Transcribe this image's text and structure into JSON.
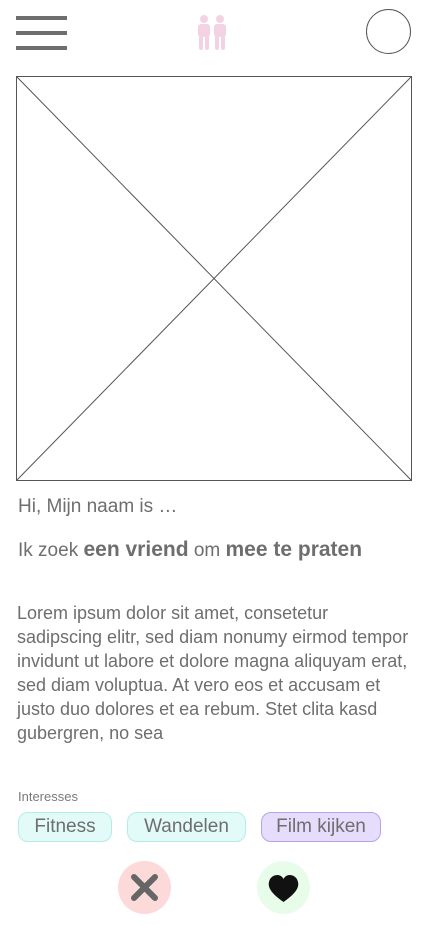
{
  "header": {
    "menu_icon": "hamburger-menu-icon",
    "logo_icon": "couple-logo-icon",
    "logo_color": "#f3d3e3",
    "profile_icon": "avatar-circle"
  },
  "profile": {
    "greeting": "Hi, Mijn naam is …",
    "seek": {
      "prefix": "Ik zoek",
      "emphasis1": "een vriend",
      "middle": "om",
      "emphasis2": "mee te praten"
    },
    "bio": "Lorem ipsum dolor sit amet, consetetur sadipscing elitr, sed diam nonumy eirmod tempor invidunt ut labore et dolore magna aliquyam erat, sed diam voluptua. At vero eos et accusam et justo duo dolores et ea rebum. Stet clita kasd gubergren, no sea"
  },
  "interests": {
    "label": "Interesses",
    "items": [
      "Fitness",
      "Wandelen",
      "Film kijken"
    ]
  },
  "actions": {
    "reject_icon": "close-x-icon",
    "reject_bg": "#fcdada",
    "like_icon": "heart-icon",
    "like_bg": "#e8fcea"
  }
}
